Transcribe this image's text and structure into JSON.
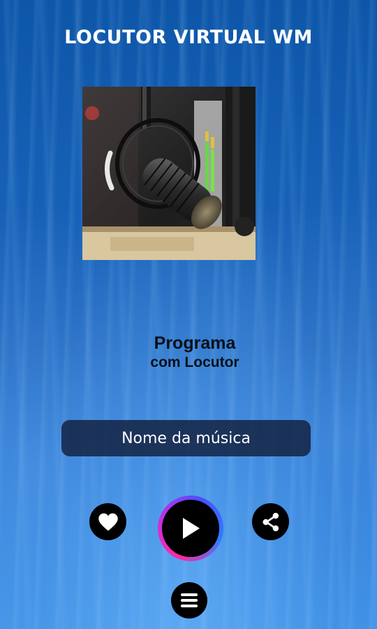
{
  "app": {
    "title": "LOCUTOR VIRTUAL WM"
  },
  "program": {
    "line1": "Programa",
    "line2": "com Locutor"
  },
  "player": {
    "song_name": "Nome da música"
  },
  "icons": {
    "like": "heart-icon",
    "play": "play-icon",
    "share": "share-icon",
    "menu": "menu-icon"
  },
  "colors": {
    "play_ring_gradient": [
      "#ff2aa0",
      "#c230e6",
      "#4a50ff",
      "#2f7cff"
    ],
    "song_box_bg": "#121e3c"
  }
}
